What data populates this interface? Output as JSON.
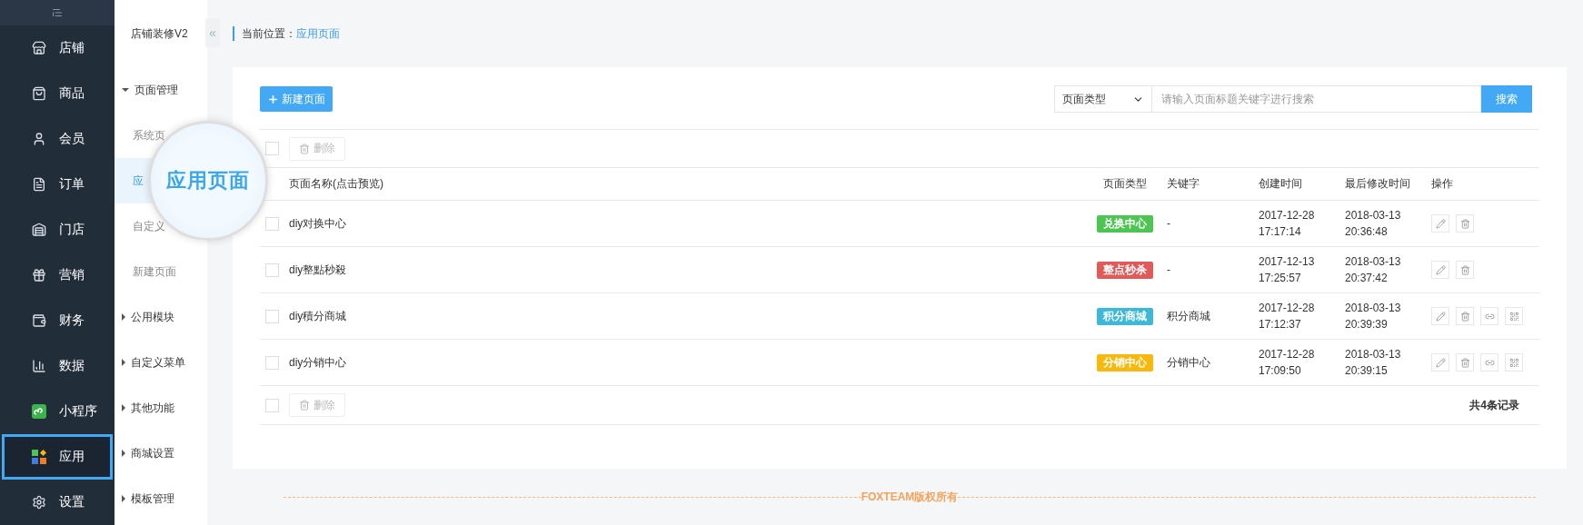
{
  "nav": {
    "items": [
      {
        "label": "店铺",
        "selected": false
      },
      {
        "label": "商品",
        "selected": false
      },
      {
        "label": "会员",
        "selected": false
      },
      {
        "label": "订单",
        "selected": false
      },
      {
        "label": "门店",
        "selected": false
      },
      {
        "label": "营销",
        "selected": false
      },
      {
        "label": "财务",
        "selected": false
      },
      {
        "label": "数据",
        "selected": false
      },
      {
        "label": "小程序",
        "selected": false
      },
      {
        "label": "应用",
        "selected": true
      },
      {
        "label": "设置",
        "selected": false
      }
    ]
  },
  "subnav": {
    "title": "店铺装修V2",
    "collapse": "«",
    "groups": [
      {
        "label": "页面管理",
        "expanded": true,
        "children": [
          {
            "label": "系统页",
            "selected": false
          },
          {
            "label": "应",
            "selected": true
          },
          {
            "label": "自定义",
            "selected": false
          },
          {
            "label": "新建页面",
            "selected": false
          }
        ]
      },
      {
        "label": "公用模块",
        "expanded": false
      },
      {
        "label": "自定义菜单",
        "expanded": false
      },
      {
        "label": "其他功能",
        "expanded": false
      },
      {
        "label": "商城设置",
        "expanded": false
      },
      {
        "label": "模板管理",
        "expanded": false
      }
    ]
  },
  "magnifier": {
    "text": "应用页面"
  },
  "breadcrumb": {
    "label": "当前位置：",
    "current": "应用页面"
  },
  "toolbar": {
    "new_button": "新建页面",
    "type_select": "页面类型",
    "search": {
      "placeholder": "请输入页面标题关键字进行搜索"
    },
    "search_button": "搜索"
  },
  "bulk": {
    "delete": "删除",
    "checked": false
  },
  "table": {
    "columns": [
      "页面名称(点击预览)",
      "页面类型",
      "关键字",
      "创建时间",
      "最后修改时间",
      "操作"
    ],
    "rows": [
      {
        "checked": false,
        "name": "diy对换中心",
        "type": "兑换中心",
        "color": "#4cc552",
        "keyword": "-",
        "created": [
          "2017-12-28",
          "17:17:14"
        ],
        "modified": [
          "2018-03-13",
          "20:36:48"
        ],
        "actions": [
          {
            "kind": "edit"
          },
          {
            "kind": "delete"
          }
        ]
      },
      {
        "checked": false,
        "name": "diy整點秒殺",
        "type": "整点秒杀",
        "color": "#e05a5a",
        "keyword": "-",
        "created": [
          "2017-12-13",
          "17:25:57"
        ],
        "modified": [
          "2018-03-13",
          "20:37:42"
        ],
        "actions": [
          {
            "kind": "edit"
          },
          {
            "kind": "delete"
          }
        ]
      },
      {
        "checked": false,
        "name": "diy積分商城",
        "type": "积分商城",
        "color": "#3db8d8",
        "keyword": "积分商城",
        "created": [
          "2017-12-28",
          "17:12:37"
        ],
        "modified": [
          "2018-03-13",
          "20:39:39"
        ],
        "actions": [
          {
            "kind": "edit"
          },
          {
            "kind": "delete"
          },
          {
            "kind": "link"
          },
          {
            "kind": "qrcode"
          }
        ]
      },
      {
        "checked": false,
        "name": "diy分销中心",
        "type": "分销中心",
        "color": "#f8b80c",
        "keyword": "分销中心",
        "created": [
          "2017-12-28",
          "17:09:50"
        ],
        "modified": [
          "2018-03-13",
          "20:39:15"
        ],
        "actions": [
          {
            "kind": "edit"
          },
          {
            "kind": "delete"
          },
          {
            "kind": "link"
          },
          {
            "kind": "qrcode"
          }
        ]
      }
    ]
  },
  "footer_bulk": {
    "delete": "删除",
    "checked": false
  },
  "total": "共4条记录",
  "copyright": "FOXTEAM版权所有"
}
